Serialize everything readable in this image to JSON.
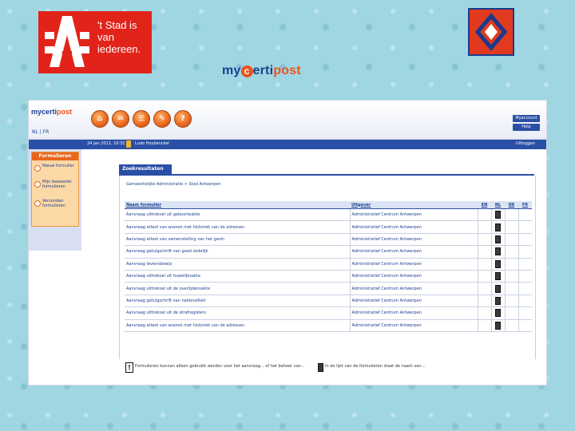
{
  "slide": {
    "antwerp_tagline": "'t Stad is van iedereen.",
    "mycertipost_title_pre": "my",
    "mycertipost_title_c": "c",
    "mycertipost_title_mid": "erti",
    "mycertipost_title_post": "post"
  },
  "app": {
    "brand_pre": "myc",
    "brand_mid": "erti",
    "brand_post": "post",
    "language": "NL | FR",
    "header_buttons": [
      "Myaccount",
      "Help"
    ],
    "status": {
      "date": "24 jan 2011, 10:31",
      "user": "Ludo Hoybenckel",
      "logout": "Uitloggen"
    },
    "sidebar": {
      "title": "Formulieren",
      "items": [
        "Nieuw formulier",
        "Mijn bewaarde formulieren",
        "Verzonden formulieren"
      ]
    },
    "results": {
      "tab": "Zoekresultaten",
      "breadcrumb": [
        "Gemeentelijke Administratie",
        "Stad Antwerpen"
      ],
      "columns": [
        "Naam formulier",
        "Uitgever",
        "EN",
        "NL",
        "DE",
        "FR"
      ],
      "rows": [
        {
          "name": "Aanvraag uittreksel uit geboorteakte",
          "publisher": "Administratief Centrum Antwerpen"
        },
        {
          "name": "Aanvraag attest van woonst met historiek van de adressen",
          "publisher": "Administratief Centrum Antwerpen"
        },
        {
          "name": "Aanvraag attest van samenstelling van het gezin",
          "publisher": "Administratief Centrum Antwerpen"
        },
        {
          "name": "Aanvraag getuigschrift van goed zedelijk",
          "publisher": "Administratief Centrum Antwerpen"
        },
        {
          "name": "Aanvraag levensbewijs",
          "publisher": "Administratief Centrum Antwerpen"
        },
        {
          "name": "Aanvraag uittreksel uit huwelijksakte",
          "publisher": "Administratief Centrum Antwerpen"
        },
        {
          "name": "Aanvraag uittreksel uit de overlijdensakte",
          "publisher": "Administratief Centrum Antwerpen"
        },
        {
          "name": "Aanvraag getuigschrift van nationaliteit",
          "publisher": "Administratief Centrum Antwerpen"
        },
        {
          "name": "Aanvraag uittreksel uit de strafregisters",
          "publisher": "Administratief Centrum Antwerpen"
        },
        {
          "name": "Aanvraag attest van woonst met historiek van de adressen",
          "publisher": "Administratief Centrum Antwerpen"
        }
      ]
    },
    "info": {
      "text_1": "Formulieren kunnen alleen gebruikt worden voor het aanvraag... of het beheer van...",
      "text_2": "In de lijst van de formulieren staat de naam van..."
    }
  }
}
